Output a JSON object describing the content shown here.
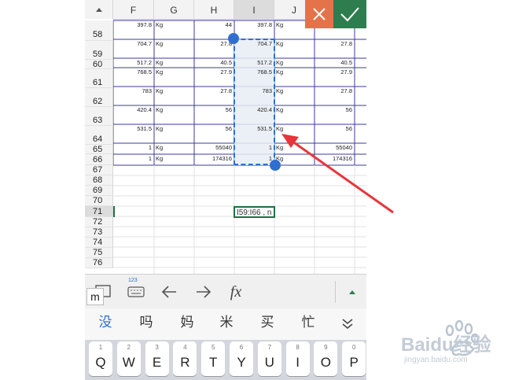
{
  "colors": {
    "accent_green": "#2e7d4f",
    "cancel_orange": "#e4734a",
    "selection_blue": "#2f6fd0",
    "grid_border": "#3b3b9a"
  },
  "sheet": {
    "columns": [
      "F",
      "G",
      "H",
      "I",
      "J"
    ],
    "rows": [
      {
        "num": "58",
        "f": "397.8",
        "g": "Kg",
        "h": "44",
        "i": "397.8",
        "j": "Kg",
        "k": ""
      },
      {
        "num": "59",
        "f": "704.7",
        "g": "Kg",
        "h": "27.8",
        "i": "704.7",
        "j": "Kg",
        "k": "27.8"
      },
      {
        "num": "60",
        "f": "517.2",
        "g": "Kg",
        "h": "40.5",
        "i": "517.2",
        "j": "Kg",
        "k": "40.5"
      },
      {
        "num": "61",
        "f": "768.5",
        "g": "Kg",
        "h": "27.9",
        "i": "768.5",
        "j": "Kg",
        "k": "27.9"
      },
      {
        "num": "62",
        "f": "783",
        "g": "Kg",
        "h": "27.8",
        "i": "783",
        "j": "Kg",
        "k": "27.8"
      },
      {
        "num": "63",
        "f": "420.4",
        "g": "Kg",
        "h": "56",
        "i": "420.4",
        "j": "Kg",
        "k": "56"
      },
      {
        "num": "64",
        "f": "531.5",
        "g": "Kg",
        "h": "56",
        "i": "531.5",
        "j": "Kg",
        "k": "56"
      },
      {
        "num": "65",
        "f": "1",
        "g": "Kg",
        "h": "55040",
        "i": "1",
        "j": "Kg",
        "k": "55040"
      },
      {
        "num": "66",
        "f": "1",
        "g": "Kg",
        "h": "174316",
        "i": "1",
        "j": "Kg",
        "k": "174316"
      }
    ],
    "empty_rows": [
      "67",
      "68",
      "69",
      "70",
      "71",
      "72",
      "73",
      "74",
      "75",
      "76"
    ],
    "active_cell_text": "I59:I66 , n"
  },
  "toolbar": {
    "keyboard_label": "123",
    "undo_icon": "arrow-left-icon",
    "redo_icon": "arrow-right-icon",
    "fx_label": "fx"
  },
  "keyboard": {
    "m_key": "m",
    "candidates": [
      "没",
      "吗",
      "妈",
      "米",
      "买",
      "忙"
    ],
    "row1": [
      {
        "n": "1",
        "l": "Q"
      },
      {
        "n": "2",
        "l": "W"
      },
      {
        "n": "3",
        "l": "E"
      },
      {
        "n": "4",
        "l": "R"
      },
      {
        "n": "5",
        "l": "T"
      },
      {
        "n": "6",
        "l": "Y"
      },
      {
        "n": "7",
        "l": "U"
      },
      {
        "n": "8",
        "l": "I"
      },
      {
        "n": "9",
        "l": "O"
      },
      {
        "n": "0",
        "l": "P"
      }
    ]
  },
  "watermark": {
    "text": "Baidu经验",
    "sub": "jingyan.baidu.com"
  }
}
